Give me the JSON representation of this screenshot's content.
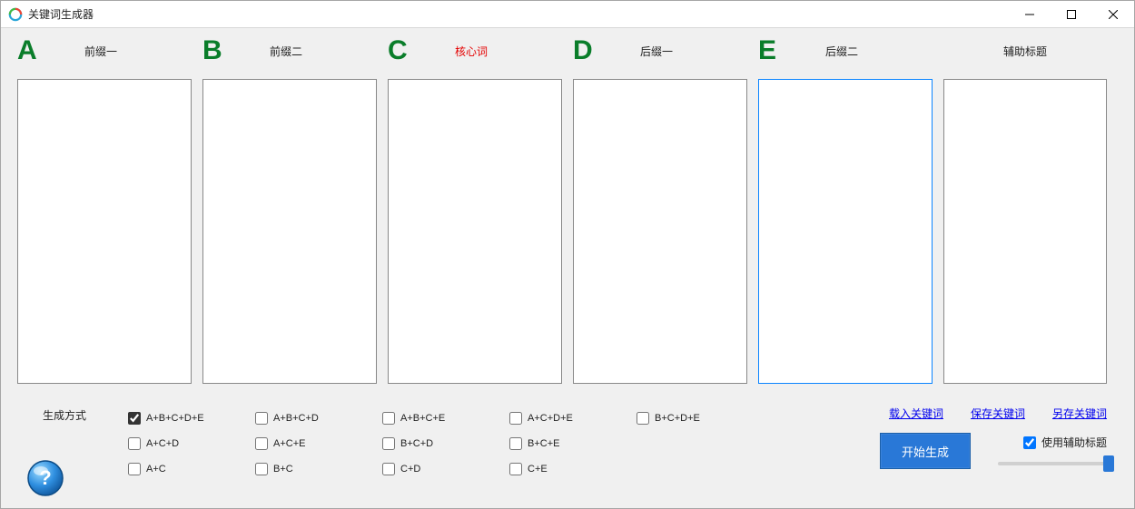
{
  "window": {
    "title": "关键词生成器"
  },
  "columns": {
    "a": {
      "letter": "A",
      "label": "前缀一"
    },
    "b": {
      "letter": "B",
      "label": "前缀二"
    },
    "c": {
      "letter": "C",
      "label": "核心词"
    },
    "d": {
      "letter": "D",
      "label": "后缀一"
    },
    "e": {
      "letter": "E",
      "label": "后缀二"
    },
    "aux": {
      "label": "辅助标题"
    }
  },
  "textareas": {
    "a": "",
    "b": "",
    "c": "",
    "d": "",
    "e": "",
    "aux": ""
  },
  "gen_mode_label": "生成方式",
  "checkboxes": {
    "r0c0": {
      "label": "A+B+C+D+E",
      "checked": true
    },
    "r0c1": {
      "label": "A+B+C+D",
      "checked": false
    },
    "r0c2": {
      "label": "A+B+C+E",
      "checked": false
    },
    "r0c3": {
      "label": "A+C+D+E",
      "checked": false
    },
    "r0c4": {
      "label": "B+C+D+E",
      "checked": false
    },
    "r1c0": {
      "label": "A+C+D",
      "checked": false
    },
    "r1c1": {
      "label": "A+C+E",
      "checked": false
    },
    "r1c2": {
      "label": "B+C+D",
      "checked": false
    },
    "r1c3": {
      "label": "B+C+E",
      "checked": false
    },
    "r2c0": {
      "label": "A+C",
      "checked": false
    },
    "r2c1": {
      "label": "B+C",
      "checked": false
    },
    "r2c2": {
      "label": "C+D",
      "checked": false
    },
    "r2c3": {
      "label": "C+E",
      "checked": false
    }
  },
  "links": {
    "load": "载入关键词",
    "save": "保存关键词",
    "save_as": "另存关键词"
  },
  "generate_button": "开始生成",
  "use_aux": {
    "label": "使用辅助标题",
    "checked": true
  },
  "slider": {
    "value": 100,
    "min": 0,
    "max": 100
  }
}
